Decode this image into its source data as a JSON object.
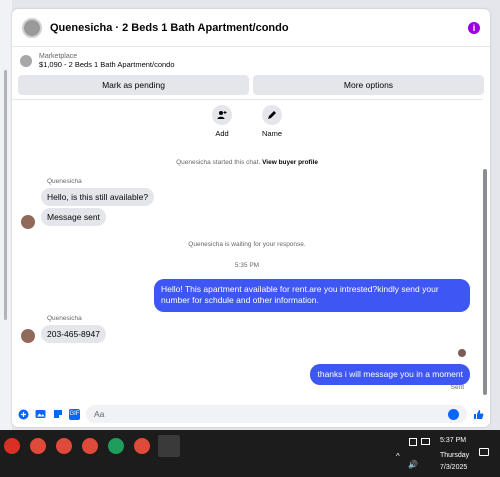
{
  "header": {
    "title": "Quenesicha · 2 Beds 1 Bath Apartment/condo"
  },
  "listing": {
    "source": "Marketplace",
    "detail": "$1,090 - 2 Beds 1 Bath Apartment/condo"
  },
  "actions": {
    "pending": "Mark as pending",
    "more": "More options"
  },
  "circle_actions": [
    {
      "label": "Add",
      "icon": "add-person-icon"
    },
    {
      "label": "Name",
      "icon": "pencil-icon"
    }
  ],
  "messages": {
    "started_prefix": "Quenesicha started this chat.",
    "view_profile": "View buyer profile",
    "sender_name": "Quenesicha",
    "msg1": "Hello, is this still available?",
    "msg2": "Message sent",
    "waiting": "Quenesicha is waiting for your response.",
    "time": "5:35 PM",
    "out1": "Hello! This apartment available for rent.are you intrested?kindly send your number for schdule and other information.",
    "sender_name2": "Quenesicha",
    "msg3": "203-465-8947",
    "out2": "thanks i will message you in a moment",
    "status": "Sent"
  },
  "composer": {
    "placeholder": "Aa"
  },
  "taskbar": {
    "time": "5:37 PM",
    "day": "Thursday",
    "date": "7/3/2025",
    "pins": [
      "chrome-icon",
      "chrome-profile-icon",
      "chrome-profile-icon",
      "chrome-profile-icon",
      "chrome-icon",
      "chrome-profile-icon",
      "chrome-profile-icon"
    ]
  },
  "colors": {
    "accent": "#0866ff",
    "outgoing": "#3e56f4",
    "info": "#9b00e0"
  }
}
